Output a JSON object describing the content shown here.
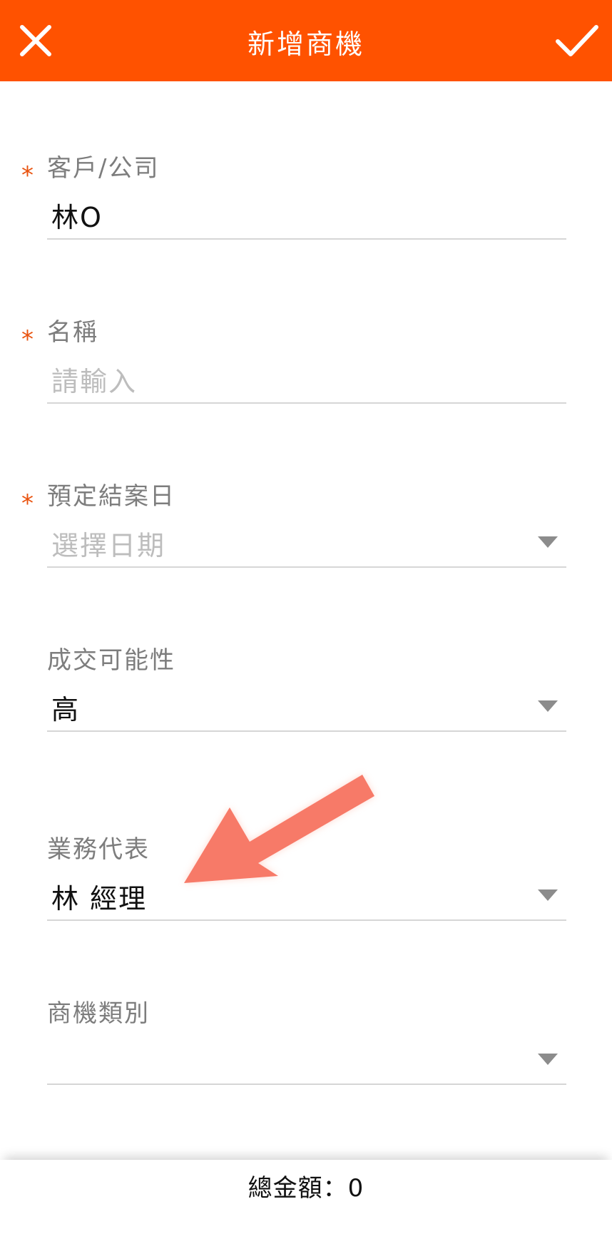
{
  "header": {
    "title": "新增商機",
    "close_icon": "close-icon",
    "confirm_icon": "check-icon",
    "color": "#ff5200"
  },
  "fields": {
    "customer": {
      "required": "*",
      "label": "客戶/公司",
      "value": "林O"
    },
    "name": {
      "required": "*",
      "label": "名稱",
      "placeholder": "請輸入"
    },
    "close_date": {
      "required": "*",
      "label": "預定結案日",
      "placeholder": "選擇日期"
    },
    "probability": {
      "label": "成交可能性",
      "value": "高"
    },
    "sales_rep": {
      "label": "業務代表",
      "value": "林 經理"
    },
    "category": {
      "label": "商機類別",
      "value": ""
    }
  },
  "footer": {
    "total_label": "總金額：0"
  },
  "colors": {
    "accent": "#ff5200",
    "required": "#e9530f",
    "annotation_arrow": "#f77a68"
  }
}
